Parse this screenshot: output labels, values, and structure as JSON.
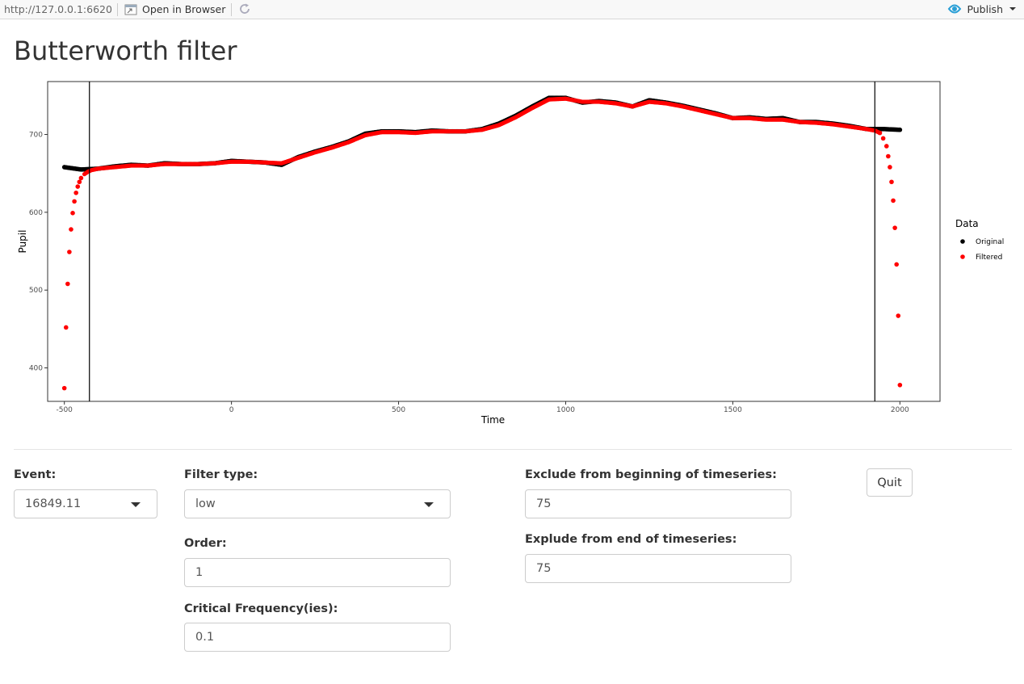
{
  "topbar": {
    "url": "http://127.0.0.1:6620",
    "open_in_browser": "Open in Browser",
    "publish": "Publish"
  },
  "page": {
    "title": "Butterworth filter"
  },
  "chart_data": {
    "type": "scatter",
    "xlabel": "Time",
    "ylabel": "Pupil",
    "xlim": [
      -550,
      2120
    ],
    "ylim": [
      357,
      768
    ],
    "xticks": [
      -500,
      0,
      500,
      1000,
      1500,
      2000
    ],
    "yticks": [
      400,
      500,
      600,
      700
    ],
    "xtick_labels": [
      "-500",
      "0",
      "500",
      "1000",
      "1500",
      "2000"
    ],
    "ytick_labels": [
      "400",
      "500",
      "600",
      "700"
    ],
    "vlines": [
      -425,
      1925
    ],
    "legend": {
      "title": "Data",
      "position": "right",
      "entries": [
        {
          "label": "Original",
          "color": "#000000"
        },
        {
          "label": "Filtered",
          "color": "#ff0000"
        }
      ]
    },
    "series": [
      {
        "name": "Original",
        "color": "#000000",
        "x": [
          -500,
          -450,
          -400,
          -350,
          -300,
          -250,
          -200,
          -150,
          -100,
          -50,
          0,
          50,
          100,
          150,
          200,
          250,
          300,
          350,
          400,
          450,
          500,
          550,
          600,
          650,
          700,
          750,
          800,
          850,
          900,
          950,
          1000,
          1050,
          1100,
          1150,
          1200,
          1250,
          1300,
          1350,
          1400,
          1450,
          1500,
          1550,
          1600,
          1650,
          1700,
          1750,
          1800,
          1850,
          1900,
          1950,
          2000
        ],
        "y": [
          658,
          655,
          656,
          659,
          661,
          660,
          663,
          662,
          662,
          663,
          666,
          665,
          664,
          661,
          671,
          678,
          684,
          691,
          701,
          704,
          704,
          703,
          705,
          704,
          704,
          707,
          714,
          724,
          736,
          747,
          747,
          741,
          743,
          741,
          736,
          744,
          741,
          737,
          732,
          727,
          721,
          722,
          720,
          721,
          716,
          716,
          714,
          711,
          707,
          707,
          706
        ]
      },
      {
        "name": "Filtered",
        "color": "#ff0000",
        "x": [
          -500,
          -495,
          -490,
          -485,
          -480,
          -475,
          -470,
          -465,
          -460,
          -455,
          -450,
          -440,
          -430,
          -420,
          -400,
          -350,
          -300,
          -250,
          -200,
          -150,
          -100,
          -50,
          0,
          50,
          100,
          150,
          200,
          250,
          300,
          350,
          400,
          450,
          500,
          550,
          600,
          650,
          700,
          750,
          800,
          850,
          900,
          950,
          1000,
          1050,
          1100,
          1150,
          1200,
          1250,
          1300,
          1350,
          1400,
          1450,
          1500,
          1550,
          1600,
          1650,
          1700,
          1750,
          1800,
          1850,
          1900,
          1925,
          1940,
          1950,
          1960,
          1965,
          1970,
          1975,
          1980,
          1985,
          1990,
          1995,
          2000
        ],
        "y": [
          374,
          452,
          508,
          549,
          578,
          599,
          614,
          625,
          633,
          639,
          644,
          649,
          652,
          654,
          656,
          658,
          660,
          660,
          662,
          662,
          662,
          663,
          665,
          665,
          664,
          663,
          670,
          677,
          683,
          690,
          699,
          703,
          703,
          702,
          704,
          704,
          704,
          706,
          712,
          722,
          734,
          745,
          746,
          742,
          742,
          740,
          736,
          742,
          740,
          736,
          731,
          726,
          721,
          721,
          719,
          719,
          716,
          715,
          713,
          710,
          707,
          705,
          702,
          695,
          685,
          672,
          658,
          639,
          615,
          580,
          533,
          467,
          378
        ]
      }
    ]
  },
  "controls": {
    "event": {
      "label": "Event:",
      "value": "16849.11"
    },
    "filter_type": {
      "label": "Filter type:",
      "value": "low"
    },
    "order": {
      "label": "Order:",
      "value": "1"
    },
    "critical_freq": {
      "label": "Critical Frequency(ies):",
      "value": "0.1"
    },
    "exclude_begin": {
      "label": "Exclude from beginning of timeseries:",
      "value": "75"
    },
    "exclude_end": {
      "label": "Explude from end of timeseries:",
      "value": "75"
    },
    "quit": {
      "label": "Quit"
    }
  }
}
